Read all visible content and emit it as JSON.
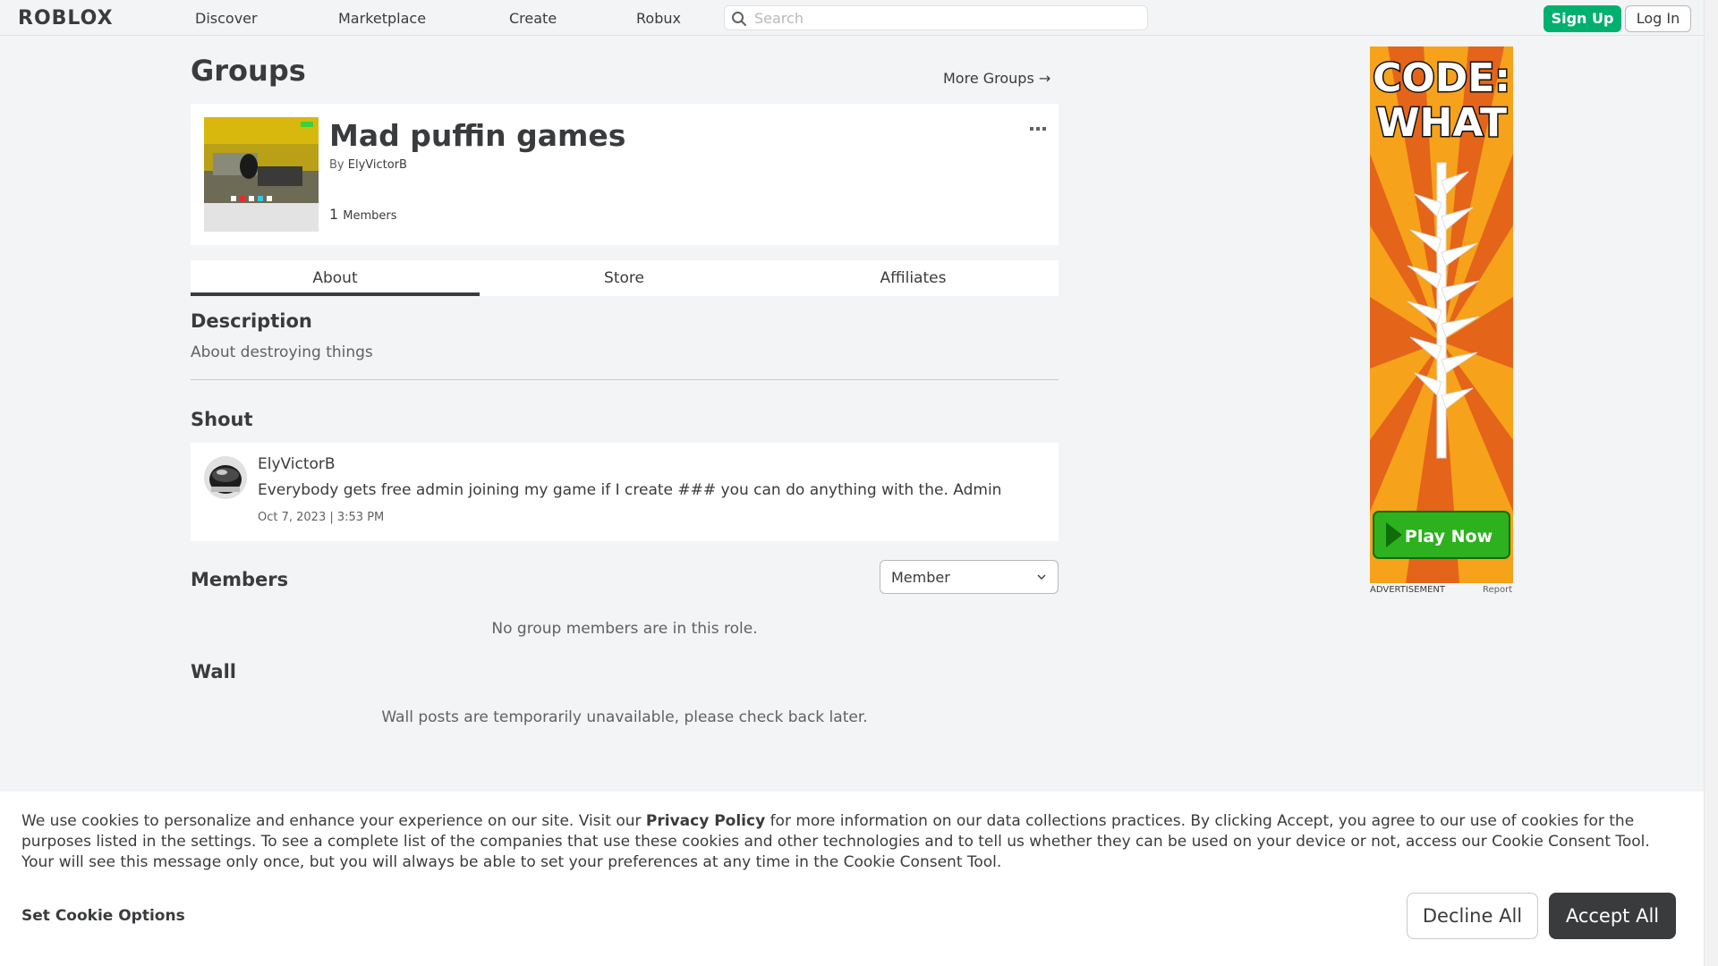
{
  "nav": {
    "logo": "ROBLOX",
    "links": [
      "Discover",
      "Marketplace",
      "Create",
      "Robux"
    ],
    "search_placeholder": "Search",
    "signup_label": "Sign Up",
    "login_label": "Log In"
  },
  "page": {
    "title": "Groups",
    "more_groups": "More Groups →"
  },
  "group": {
    "name": "Mad puffin games",
    "by_label": "By",
    "owner": "ElyVictorB",
    "member_count": "1",
    "member_label": "Members",
    "more_icon": "more-dots-icon"
  },
  "tabs": [
    "About",
    "Store",
    "Affiliates"
  ],
  "description": {
    "title": "Description",
    "text": "About destroying things"
  },
  "shout": {
    "title": "Shout",
    "user": "ElyVictorB",
    "body": "Everybody gets free admin joining my game if I create ### you can do anything with the. Admin",
    "date": "Oct 7, 2023 | 3:53 PM"
  },
  "members": {
    "title": "Members",
    "role_selected": "Member",
    "empty_message": "No group members are in this role."
  },
  "wall": {
    "title": "Wall",
    "message": "Wall posts are temporarily unavailable, please check back later."
  },
  "ad": {
    "headline_line1": "CODE:",
    "headline_line2": "WHAT",
    "cta": "Play Now",
    "label": "ADVERTISEMENT",
    "report": "Report"
  },
  "cookie": {
    "text_part1": "We use cookies to personalize and enhance your experience on our site. Visit our ",
    "privacy_link": "Privacy Policy",
    "text_part2": " for more information on our data collections practices. By clicking Accept, you agree to our use of cookies for the purposes listed in the settings. To see a complete list of the companies that use these cookies and other technologies and to tell us whether they can be used on your device or not, access our Cookie Consent Tool. Your will see this message only once, but you will always be able to set your preferences at any time in the Cookie Consent Tool.",
    "options_label": "Set Cookie Options",
    "decline_label": "Decline All",
    "accept_label": "Accept All"
  },
  "colors": {
    "primary_green": "#00b06f",
    "text_dark": "#393b3d",
    "background": "#f2f4f5"
  }
}
